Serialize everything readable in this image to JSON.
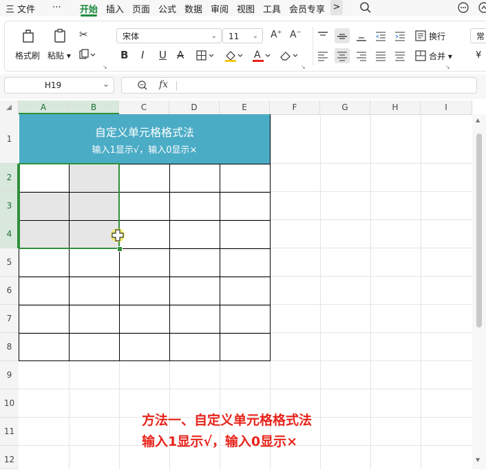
{
  "menu": {
    "items": [
      "三 文件",
      "⋯",
      "开始",
      "插入",
      "页面",
      "公式",
      "数据",
      "审阅",
      "视图",
      "工具",
      "会员专享"
    ],
    "more": ">"
  },
  "ribbon": {
    "format_painter": "格式刷",
    "paste": "粘贴",
    "font_name": "宋体",
    "font_size": "11",
    "wrap": "换行",
    "merge": "合并",
    "general": "常",
    "currency": "¥"
  },
  "formula_bar": {
    "name_box": "H19",
    "fx": "fx",
    "value": ""
  },
  "columns": [
    "A",
    "B",
    "C",
    "D",
    "E",
    "F",
    "G",
    "H",
    "I"
  ],
  "rows": [
    "1",
    "2",
    "3",
    "4",
    "5",
    "6",
    "7",
    "8",
    "9",
    "10",
    "11",
    "12"
  ],
  "sheet": {
    "title": "自定义单元格格式法",
    "subtitle": "输入1显示√，输入0显示×"
  },
  "annotation": {
    "line1": "方法一、自定义单元格格式法",
    "line2": "输入1显示√，输入0显示×"
  },
  "colors": {
    "accent": "#1b8a3c",
    "header_fill": "#4bacc6",
    "annotation_red": "#e8231a",
    "selection": "#2f8f3a"
  }
}
